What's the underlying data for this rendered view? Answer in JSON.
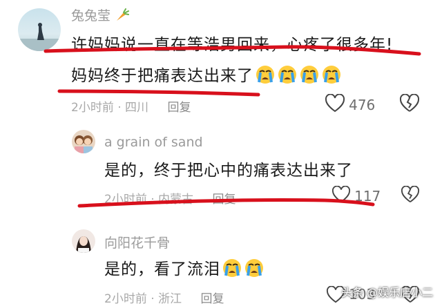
{
  "comments": [
    {
      "username": "兔兔莹",
      "text_line1": "许妈妈说一直在等浩男回来，心疼了很多年!",
      "text_line2": "妈妈终于把痛表达出来了",
      "time": "2小时前",
      "location": "四川",
      "reply_label": "回复",
      "likes": "476"
    },
    {
      "username": "a grain of sand",
      "text": "是的，终于把心中的痛表达出来了",
      "time": "2小时前",
      "location": "内蒙古",
      "reply_label": "回复",
      "likes": "117"
    },
    {
      "username": "向阳花千骨",
      "text": "是的，看了流泪",
      "time": "2小时前",
      "location": "浙江",
      "reply_label": "回复",
      "likes": "103"
    }
  ],
  "watermark": "头条 @娱乐店小二",
  "colors": {
    "annotation_red": "#d8101c",
    "like_icon": "#444444"
  },
  "icons": [
    "carrot-icon",
    "crying-face-emoji",
    "heart-icon",
    "broken-heart-icon"
  ]
}
